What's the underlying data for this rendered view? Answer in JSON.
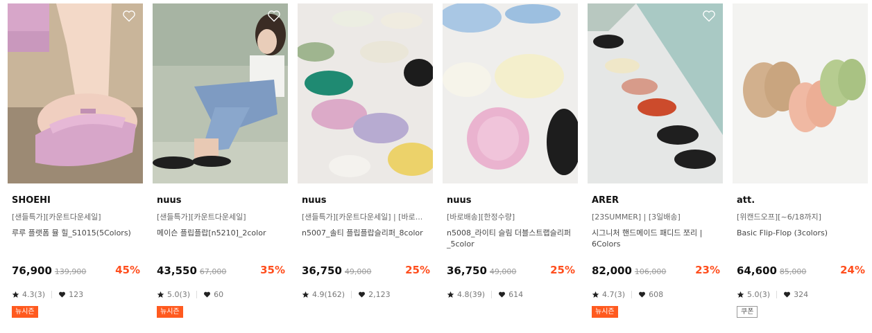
{
  "products": [
    {
      "brand": "SHOEHI",
      "promo": "[샌들특가][카운트다운세일]",
      "name": "루루 플랫폼 뮬 힐_S1015(5Colors)",
      "price": "76,900",
      "original_price": "139,900",
      "discount": "45%",
      "rating": "4.3(3)",
      "likes": "123",
      "badge": "뉴시즌",
      "badge_type": "new",
      "liked_icon": "heart-outline-icon"
    },
    {
      "brand": "nuus",
      "promo": "[샌들특가][카운트다운세일]",
      "name": "메이슨 플립플랍[n5210]_2color",
      "price": "43,550",
      "original_price": "67,000",
      "discount": "35%",
      "rating": "5.0(3)",
      "likes": "60",
      "badge": "뉴시즌",
      "badge_type": "new",
      "liked_icon": "heart-outline-icon"
    },
    {
      "brand": "nuus",
      "promo": "[샌들특가][카운트다운세일] | [바로...",
      "name": "n5007_솔티 플립플랍슬리퍼_8color",
      "price": "36,750",
      "original_price": "49,000",
      "discount": "25%",
      "rating": "4.9(162)",
      "likes": "2,123",
      "badge": "",
      "badge_type": "none",
      "liked_icon": "heart-outline-icon"
    },
    {
      "brand": "nuus",
      "promo": "[바로배송][한정수량]",
      "name": "n5008_라이티 슬림 더블스트랩슬리퍼_5color",
      "price": "36,750",
      "original_price": "49,000",
      "discount": "25%",
      "rating": "4.8(39)",
      "likes": "614",
      "badge": "",
      "badge_type": "none",
      "liked_icon": "heart-outline-icon"
    },
    {
      "brand": "ARER",
      "promo": "[23SUMMER] | [3일배송]",
      "name": "시그니처 핸드메이드 패디드 쪼리 | 6Colors",
      "price": "82,000",
      "original_price": "106,000",
      "discount": "23%",
      "rating": "4.7(3)",
      "likes": "608",
      "badge": "뉴시즌",
      "badge_type": "new",
      "liked_icon": "heart-outline-icon"
    },
    {
      "brand": "att.",
      "promo": "[위캔드오프][~6/18까지]",
      "name": "Basic Flip-Flop (3colors)",
      "price": "64,600",
      "original_price": "85,000",
      "discount": "24%",
      "rating": "5.0(3)",
      "likes": "324",
      "badge": "쿠폰",
      "badge_type": "coupon",
      "liked_icon": "heart-outline-icon"
    }
  ],
  "colors": {
    "discount": "#ff4e1d",
    "badge_new": "#ff5a1f",
    "text": "#222222"
  },
  "icons": {
    "rating": "star-icon",
    "likes": "heart-filled-icon",
    "wishlist": "heart-outline-icon"
  }
}
